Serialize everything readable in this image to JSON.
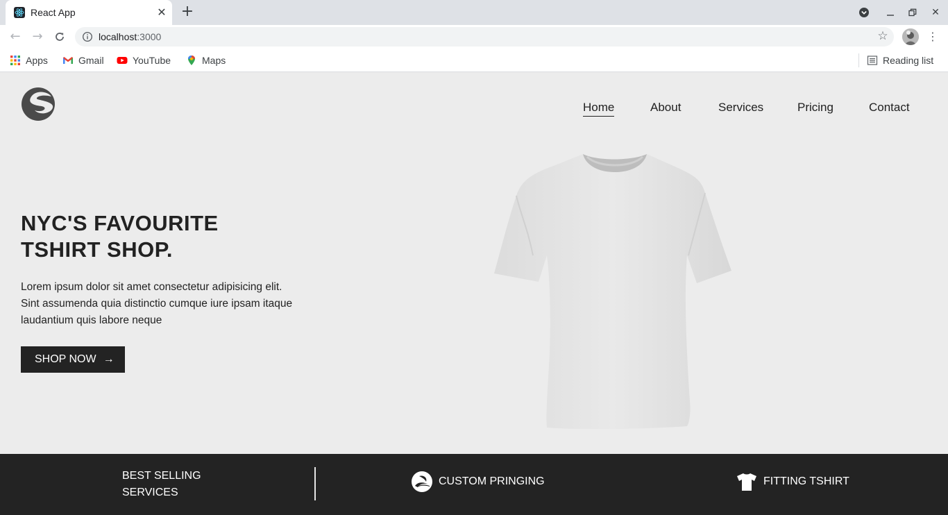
{
  "browser": {
    "tab": {
      "title": "React App"
    },
    "address": {
      "host": "localhost",
      "port": ":3000"
    },
    "bookmarks": [
      {
        "label": "Apps",
        "icon": "apps-grid-icon"
      },
      {
        "label": "Gmail",
        "icon": "gmail-icon"
      },
      {
        "label": "YouTube",
        "icon": "youtube-icon"
      },
      {
        "label": "Maps",
        "icon": "maps-icon"
      }
    ],
    "reading_list": "Reading list"
  },
  "site": {
    "nav": {
      "home": "Home",
      "about": "About",
      "services": "Services",
      "pricing": "Pricing",
      "contact": "Contact"
    },
    "hero": {
      "title_line1": "NYC'S FAVOURITE",
      "title_line2": "TSHIRT SHOP.",
      "text": "Lorem ipsum dolor sit amet consectetur adipisicing elit. Sint assumenda quia distinctio cumque iure ipsam itaque laudantium quis labore neque",
      "cta": "SHOP NOW",
      "cta_arrow": "→"
    },
    "features": {
      "item1_line1": "BEST SELLING",
      "item1_line2": "SERVICES",
      "item2": "CUSTOM PRINGING",
      "item3": "FITTING TSHIRT"
    }
  },
  "colors": {
    "page_bg": "#ececec",
    "dark": "#232323",
    "text": "#222222"
  }
}
